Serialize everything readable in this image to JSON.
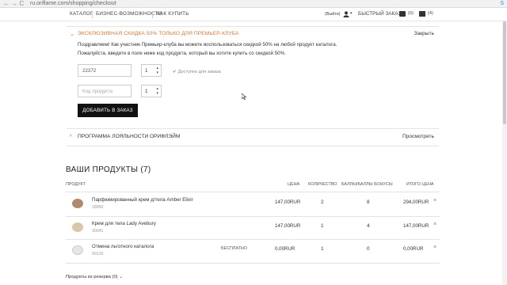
{
  "browser": {
    "nav_glyphs": "← → C",
    "url": "ru.oriflame.com/shopping/checkout",
    "extension_icon": "skype-icon"
  },
  "topnav": {
    "links": [
      "КАТАЛОГ",
      "БИЗНЕС-ВОЗМОЖНОСТИ",
      "КАК КУПИТЬ"
    ],
    "logout": "(Выйти)",
    "quick_order": "БЫСТРЫЙ ЗАКАЗ",
    "messages_count": "(0)",
    "bag_count": "(4)"
  },
  "promo_panel": {
    "title": "ЭКСКЛЮЗИВНАЯ СКИДКА 50% ТОЛЬКО ДЛЯ ПРЕМЬЕР-КЛУБА",
    "close_label": "Закрыть",
    "text_line1": "Поздравляем! Как участник Премьер-клуба вы можете воспользоваться скидкой 50% на любой продукт каталога.",
    "text_line2": "Пожалуйста, введите в поле ниже код продукта, который вы хотите купить со скидкой 50%.",
    "code_value": "22372",
    "qty_value": "1",
    "availability": "Доступно для заказа",
    "code_placeholder": "Код продукта",
    "qty_value_2": "1",
    "add_button": "ДОБАВИТЬ В ЗАКАЗ"
  },
  "loyalty_panel": {
    "title": "ПРОГРАММА ЛОЯЛЬНОСТИ ОРИФЛЭЙМ",
    "view_label": "Просмотреть"
  },
  "products": {
    "title": "ВАШИ ПРОДУКТЫ (7)",
    "columns": {
      "product": "ПРОДУКТ",
      "price": "ЦЕНА",
      "quantity": "КОЛИЧЕСТВО",
      "points": "БАЛЛЫ/БАЛЛЫ БОНУСЫ",
      "total": "ИТОГО ЦЕНА"
    },
    "rows": [
      {
        "name": "Парфюмированный крем д/тела Amber Elixir",
        "code": "18950",
        "free": "",
        "price": "147,00RUR",
        "qty": "2",
        "points": "8",
        "total": "294,00RUR",
        "thumb_color": "#b08a70"
      },
      {
        "name": "Крем для тела Lady Avebury",
        "code": "30041",
        "free": "",
        "price": "147,00RUR",
        "qty": "1",
        "points": "4",
        "total": "147,00RUR",
        "thumb_color": "#d8c8a8"
      },
      {
        "name": "Отмена льготного каталога",
        "code": "90120",
        "free": "БЕСПЛАТНО",
        "price": "0,00RUR",
        "qty": "1",
        "points": "0",
        "total": "0,00RUR",
        "thumb_color": "#e6e6e6"
      }
    ],
    "remove_glyph": "×"
  },
  "reserve": {
    "label": "Продукты из резерва (0)"
  },
  "colors": {
    "accent": "#d8793a",
    "button_bg": "#111111"
  }
}
